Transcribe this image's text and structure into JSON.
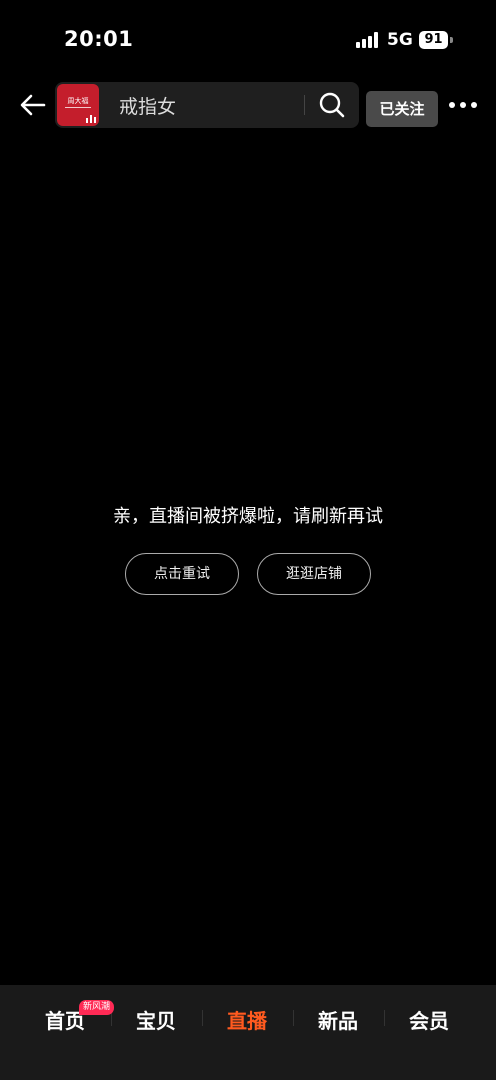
{
  "status_bar": {
    "time": "20:01",
    "network": "5G",
    "battery": "91"
  },
  "header": {
    "store_logo_text": "周大福",
    "search_query": "戒指女",
    "follow_label": "已关注"
  },
  "live_room": {
    "error_message": "亲，直播间被挤爆啦，请刷新再试",
    "retry_label": "点击重试",
    "shop_label": "逛逛店铺"
  },
  "tabs": {
    "items": [
      {
        "label": "首页"
      },
      {
        "label": "宝贝"
      },
      {
        "label": "直播"
      },
      {
        "label": "新品"
      },
      {
        "label": "会员"
      }
    ],
    "active_index": 2,
    "home_badge": "新风潮"
  },
  "colors": {
    "accent": "#ff5a1f",
    "logo_red": "#c41e2c",
    "badge": "#ff2a55"
  }
}
